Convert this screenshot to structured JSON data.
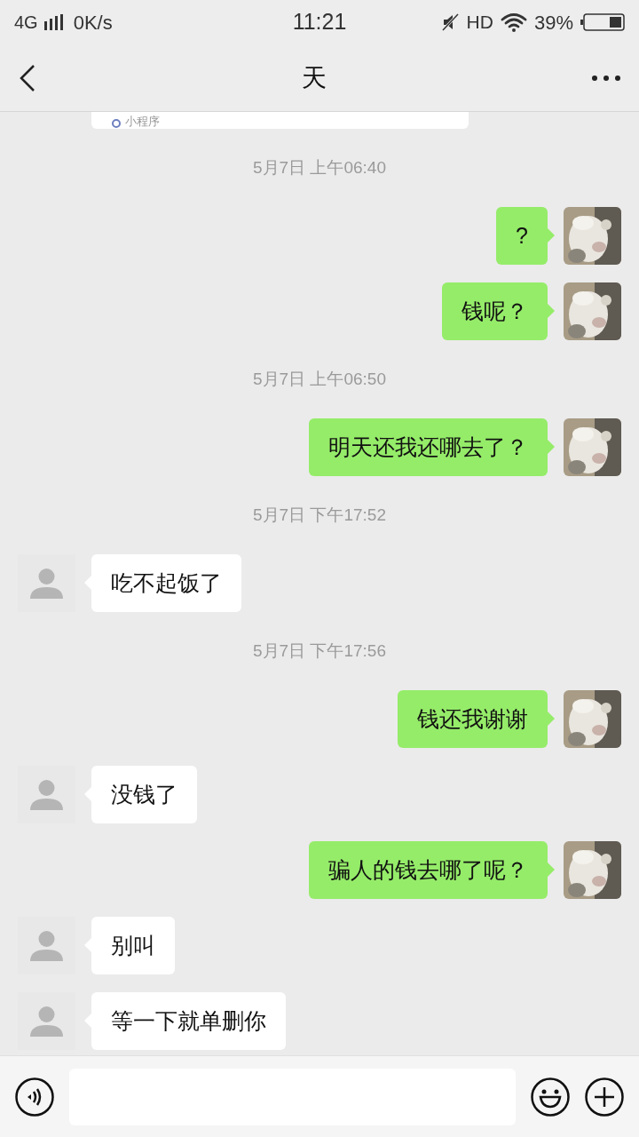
{
  "status_bar": {
    "network": "4G",
    "speed": "0K/s",
    "time": "11:21",
    "hd": "HD",
    "battery": "39%"
  },
  "header": {
    "title": "天"
  },
  "card": {
    "label": "小程序"
  },
  "messages": [
    {
      "kind": "time",
      "text": "5月7日 上午06:40"
    },
    {
      "kind": "out",
      "text": "?"
    },
    {
      "kind": "out",
      "text": "钱呢？"
    },
    {
      "kind": "time",
      "text": "5月7日 上午06:50"
    },
    {
      "kind": "out",
      "text": "明天还我还哪去了？"
    },
    {
      "kind": "time",
      "text": "5月7日 下午17:52"
    },
    {
      "kind": "in",
      "text": "吃不起饭了"
    },
    {
      "kind": "time",
      "text": "5月7日 下午17:56"
    },
    {
      "kind": "out",
      "text": "钱还我谢谢"
    },
    {
      "kind": "in",
      "text": "没钱了"
    },
    {
      "kind": "out",
      "text": "骗人的钱去哪了呢？"
    },
    {
      "kind": "in",
      "text": "别叫"
    },
    {
      "kind": "in",
      "text": "等一下就单删你"
    }
  ]
}
